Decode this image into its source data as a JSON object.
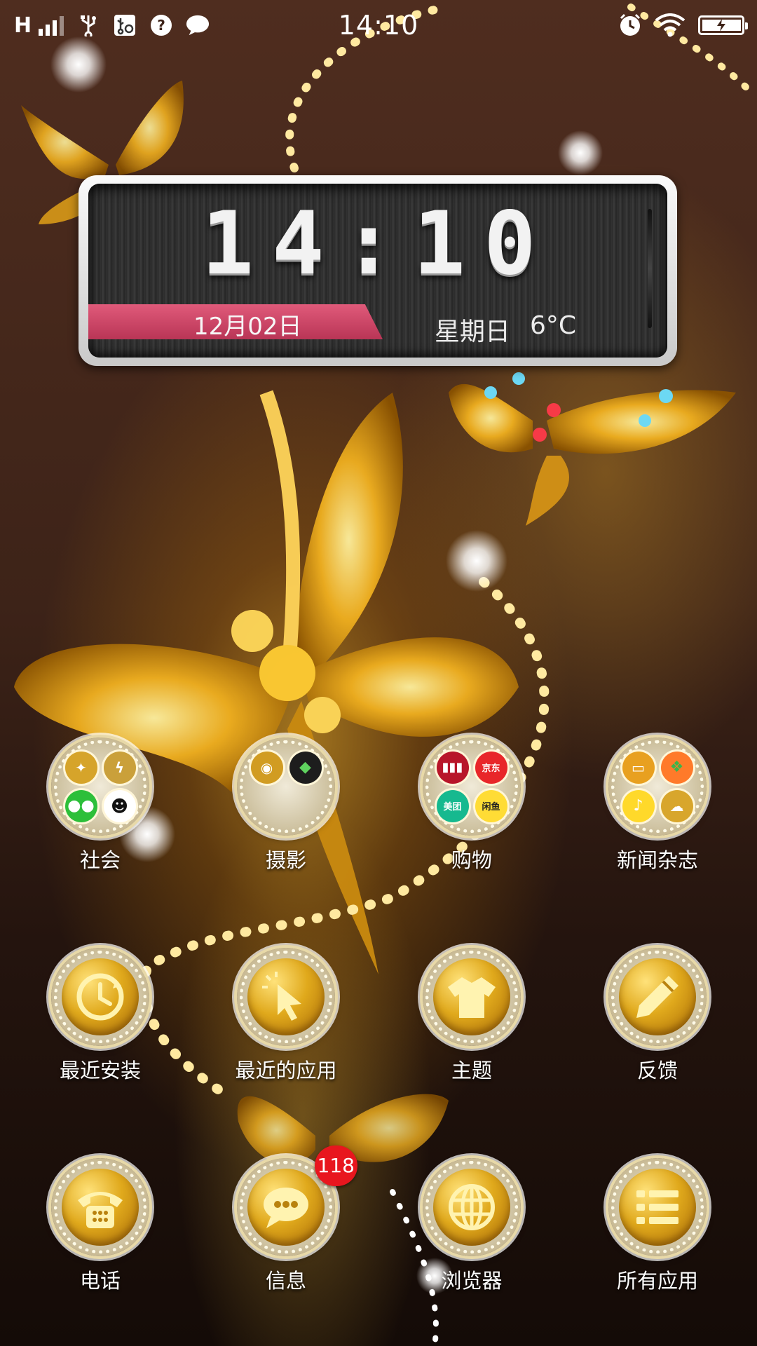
{
  "status_bar": {
    "network_type": "H",
    "time": "14:10",
    "icons": [
      "signal-icon",
      "usb-icon",
      "usb-debugging-icon",
      "question-icon",
      "message-icon",
      "alarm-icon",
      "wifi-icon",
      "battery-charging-icon"
    ],
    "signal_level": 3
  },
  "clock_widget": {
    "time": "14:10",
    "date": "12月02日",
    "weekday": "星期日",
    "temperature": "6°C"
  },
  "folders": [
    {
      "label": "社会",
      "apps": [
        "Tool",
        "Messenger",
        "WeChat",
        "QQ"
      ]
    },
    {
      "label": "摄影",
      "apps": [
        "Camera",
        "Snapseed"
      ]
    },
    {
      "label": "购物",
      "apps": [
        "Barcode",
        "京东",
        "美团",
        "闲鱼"
      ]
    },
    {
      "label": "新闻杂志",
      "apps": [
        "Reader",
        "Magazine",
        "Music",
        "Cloud"
      ]
    }
  ],
  "apps_row2": [
    {
      "label": "最近安装",
      "icon": "clock-icon"
    },
    {
      "label": "最近的应用",
      "icon": "cursor-icon"
    },
    {
      "label": "主题",
      "icon": "tshirt-icon"
    },
    {
      "label": "反馈",
      "icon": "pencil-icon"
    }
  ],
  "dock": [
    {
      "label": "电话",
      "icon": "phone-icon"
    },
    {
      "label": "信息",
      "icon": "chat-icon",
      "badge": "118"
    },
    {
      "label": "浏览器",
      "icon": "globe-icon"
    },
    {
      "label": "所有应用",
      "icon": "list-icon"
    }
  ],
  "colors": {
    "gold": "#e0a91c",
    "badge_red": "#e8161e",
    "date_band": "#c93b5f"
  }
}
